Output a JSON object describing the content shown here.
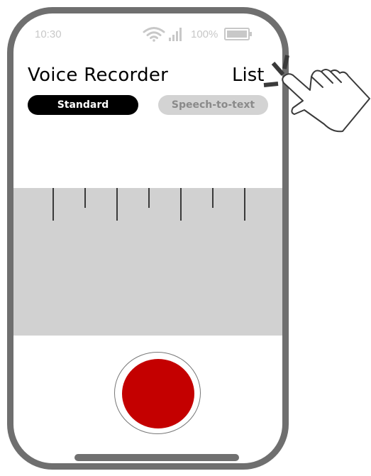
{
  "status_bar": {
    "time": "10:30",
    "battery_percent": "100%",
    "wifi_icon": "wifi-icon",
    "signal_icon": "signal-bars-icon",
    "battery_icon": "battery-full-icon"
  },
  "header": {
    "title": "Voice Recorder",
    "list_label": "List"
  },
  "mode_tabs": [
    {
      "label": "Standard",
      "selected": true
    },
    {
      "label": "Speech-to-text",
      "selected": false
    }
  ],
  "waveform": {
    "tick_heights": [
      "long",
      "short",
      "long",
      "short",
      "long",
      "short",
      "long"
    ]
  },
  "record_button": {
    "icon": "record-icon",
    "color": "#c40000"
  },
  "annotation": {
    "icon": "pointing-hand-icon"
  },
  "colors": {
    "phone_frame": "#6f6f6f",
    "selected_tab": "#000000",
    "unselected_tab": "#d3d3d3",
    "waveform_bg": "#d1d1d1"
  }
}
